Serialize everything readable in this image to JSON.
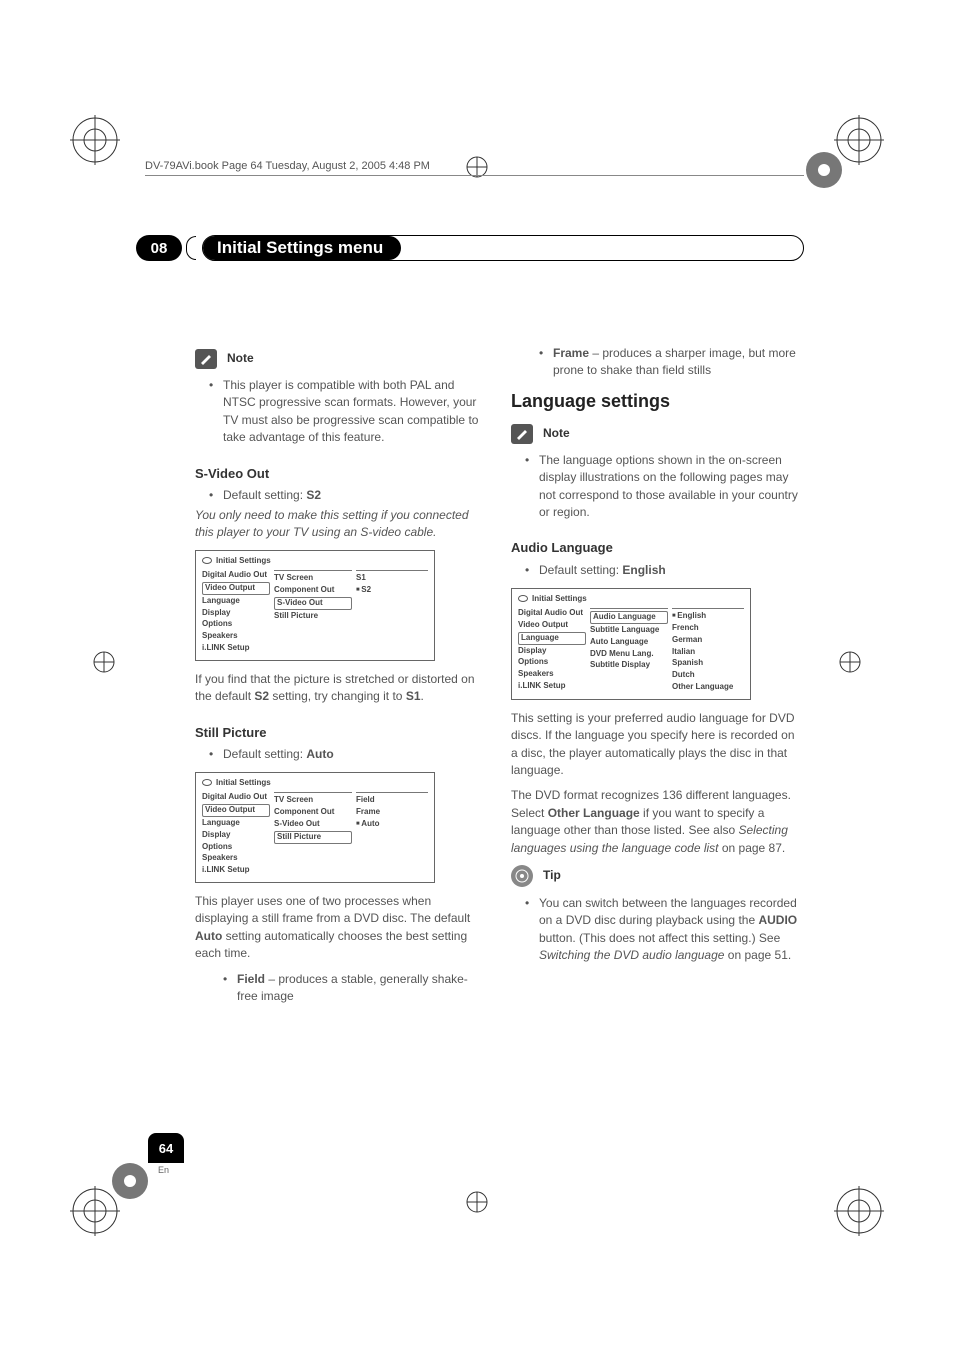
{
  "header": {
    "text": "DV-79AVi.book  Page 64  Tuesday, August 2, 2005  4:48 PM"
  },
  "chapter": {
    "number": "08",
    "title": "Initial Settings menu"
  },
  "left": {
    "note_label": "Note",
    "note_bullet": "This player is compatible with both PAL and NTSC progressive scan formats. However, your TV must also be progressive scan compatible to take advantage of this feature.",
    "svideo": {
      "heading": "S-Video Out",
      "default": "Default setting: ",
      "default_val": "S2",
      "italic": "You only need to make this setting if you connected this player to your TV using an S-video cable.",
      "after": "If you find that the picture is stretched or distorted on the default ",
      "after_b1": "S2",
      "after_mid": " setting, try changing it to ",
      "after_b2": "S1",
      "after_end": "."
    },
    "still": {
      "heading": "Still Picture",
      "default": "Default setting: ",
      "default_val": "Auto",
      "para": "This player uses one of two processes when displaying a still frame from a DVD disc. The default ",
      "para_b": "Auto",
      "para_end": " setting automatically chooses the best setting each time.",
      "b1": "Field",
      "b1_t": " – produces a stable, generally shake-free image"
    },
    "menu1": {
      "title": "Initial Settings",
      "c1": [
        "Digital Audio Out",
        "Video Output",
        "Language",
        "Display",
        "Options",
        "Speakers",
        "i.LINK Setup"
      ],
      "c2": [
        "TV Screen",
        "Component Out",
        "S-Video Out",
        "Still Picture"
      ],
      "c3": [
        "S1",
        "S2"
      ],
      "boxed_c1": 1,
      "boxed_c2": 2,
      "sq_c3": 1
    },
    "menu2": {
      "title": "Initial Settings",
      "c1": [
        "Digital Audio Out",
        "Video Output",
        "Language",
        "Display",
        "Options",
        "Speakers",
        "i.LINK Setup"
      ],
      "c2": [
        "TV Screen",
        "Component Out",
        "S-Video Out",
        "Still Picture"
      ],
      "c3": [
        "Field",
        "Frame",
        "Auto"
      ],
      "boxed_c1": 1,
      "boxed_c2": 3,
      "sq_c3": 2
    }
  },
  "right": {
    "frame_b": "Frame",
    "frame_t": " – produces a sharper image, but more prone to shake than field stills",
    "h2": "Language settings",
    "note_label": "Note",
    "note_bullet": "The language options shown in the on-screen display illustrations on the following pages may not correspond to those available in your country or region.",
    "audio": {
      "heading": "Audio Language",
      "default": "Default setting: ",
      "default_val": "English",
      "p1": "This setting is your preferred audio language for DVD discs. If the language you specify here is recorded on a disc, the player automatically plays the disc in that language.",
      "p2a": "The DVD format recognizes 136 different languages. Select ",
      "p2b": "Other Language",
      "p2c": " if you want to specify a language other than those listed. See also ",
      "p2i": "Selecting languages using the language code list",
      "p2d": " on page 87."
    },
    "tip_label": "Tip",
    "tip_a": "You can switch between the languages recorded on a DVD disc during playback using the ",
    "tip_b": "AUDIO",
    "tip_c": " button. (This does not affect this setting.) See ",
    "tip_i": "Switching the DVD audio language",
    "tip_d": " on page 51.",
    "menu3": {
      "title": "Initial Settings",
      "c1": [
        "Digital Audio Out",
        "Video Output",
        "Language",
        "Display",
        "Options",
        "Speakers",
        "i.LINK Setup"
      ],
      "c2": [
        "Audio Language",
        "Subtitle Language",
        "Auto Language",
        "DVD Menu Lang.",
        "Subtitle Display"
      ],
      "c3": [
        "English",
        "French",
        "German",
        "Italian",
        "Spanish",
        "Dutch",
        "Other Language"
      ],
      "boxed_c1": 2,
      "boxed_c2": 0,
      "sq_c3": 0
    }
  },
  "footer": {
    "page": "64",
    "lang": "En"
  }
}
